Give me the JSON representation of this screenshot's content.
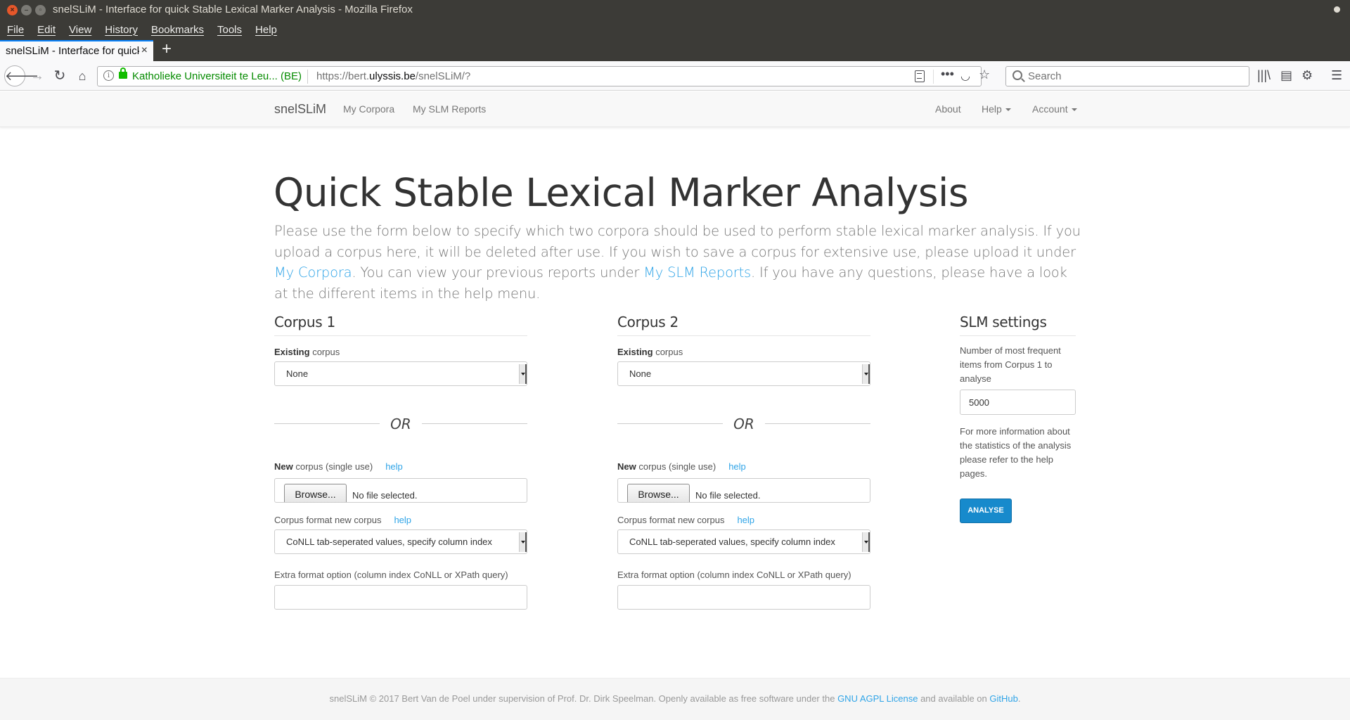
{
  "window": {
    "title": "snelSLiM - Interface for quick Stable Lexical Marker Analysis - Mozilla Firefox"
  },
  "menubar": [
    "File",
    "Edit",
    "View",
    "History",
    "Bookmarks",
    "Tools",
    "Help"
  ],
  "tab": {
    "title": "snelSLiM - Interface for quick Stable Lexical Marker Analysis",
    "close": "×",
    "new_tab": "+"
  },
  "urlbar": {
    "site_identity": "Katholieke Universiteit te Leu...  (BE)",
    "url_prefix": "https://bert.",
    "url_domain": "ulyssis.be",
    "url_path": "/snelSLiM/?",
    "search_placeholder": "Search"
  },
  "site_nav": {
    "brand": "snelSLiM",
    "links": [
      "My Corpora",
      "My SLM Reports"
    ],
    "right_links": [
      "About",
      "Help",
      "Account"
    ]
  },
  "hero": {
    "title": "Quick Stable Lexical Marker Analysis",
    "lead_1": "Please use the form below to specify which two corpora should be used to perform stable lexical marker analysis. If you upload a corpus here, it will be deleted after use. If you wish to save a corpus for extensive use, please upload it under ",
    "lead_link_1": "My Corpora",
    "lead_2": ". You can view your previous reports under ",
    "lead_link_2": "My SLM Reports",
    "lead_3": ". If you have any questions, please have a look at the different items in the help menu."
  },
  "corpus1": {
    "heading": "Corpus 1",
    "existing_label_bold": "Existing",
    "existing_label_rest": " corpus",
    "existing_value": "None",
    "or": "OR",
    "new_label_bold": "New",
    "new_label_rest": " corpus (single use)",
    "help": "help",
    "browse": "Browse...",
    "no_file": "No file selected.",
    "format_label": "Corpus format new corpus",
    "format_value": "CoNLL tab-seperated values, specify column index",
    "extra_label": "Extra format option (column index CoNLL or XPath query)",
    "extra_value": ""
  },
  "corpus2": {
    "heading": "Corpus 2",
    "existing_label_bold": "Existing",
    "existing_label_rest": " corpus",
    "existing_value": "None",
    "or": "OR",
    "new_label_bold": "New",
    "new_label_rest": " corpus (single use)",
    "help": "help",
    "browse": "Browse...",
    "no_file": "No file selected.",
    "format_label": "Corpus format new corpus",
    "format_value": "CoNLL tab-seperated values, specify column index",
    "extra_label": "Extra format option (column index CoNLL or XPath query)",
    "extra_value": ""
  },
  "settings": {
    "heading": "SLM settings",
    "freq_label": "Number of most frequent items from Corpus 1 to analyse",
    "freq_value": "5000",
    "info": "For more information about the statistics of the analysis please refer to the help pages.",
    "button": "ANALYSE"
  },
  "footer": {
    "text_1": "snelSLiM © 2017 Bert Van de Poel under supervision of Prof. Dr. Dirk Speelman. Openly available as free software under the ",
    "link_1": "GNU AGPL License",
    "text_2": " and available on ",
    "link_2": "GitHub",
    "text_3": "."
  },
  "colors": {
    "accent": "#2fa4e7",
    "button": "#178acc",
    "secure_green": "#058b00",
    "chrome_dark": "#3c3b37"
  }
}
